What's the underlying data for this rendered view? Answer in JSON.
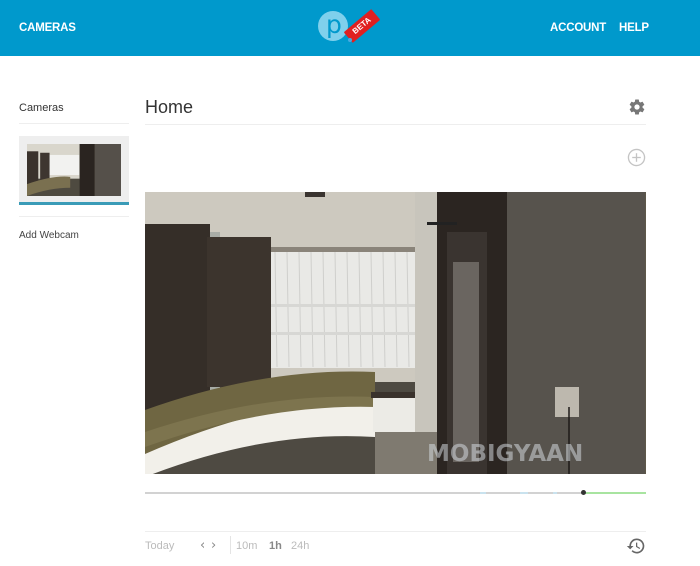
{
  "topbar": {
    "nav_left": "CAMERAS",
    "logo_letter": "p",
    "logo_badge": "BETA",
    "nav_account": "ACCOUNT",
    "nav_help": "HELP",
    "bg_color": "#0099cc"
  },
  "sidebar": {
    "title": "Cameras",
    "cameras": [
      {
        "name": "Home",
        "selected": true
      }
    ],
    "add_webcam_label": "Add Webcam",
    "selected_indicator_color": "#3a9bb7"
  },
  "main": {
    "title": "Home",
    "settings_icon": "gear-icon",
    "add_icon": "add-circle-icon",
    "feed": {
      "watermark": "MOBIGYAAN"
    },
    "timeline": {
      "playhead_fraction": 0.874,
      "recorded_from_fraction": 0.874,
      "recorded_to_fraction": 1.0
    },
    "controls": {
      "today_label": "Today",
      "prev_icon": "chevron-left-icon",
      "next_icon": "chevron-right-icon",
      "zoom_options": [
        "10m",
        "1h",
        "24h"
      ],
      "selected_zoom": "1h",
      "history_icon": "history-icon"
    }
  }
}
